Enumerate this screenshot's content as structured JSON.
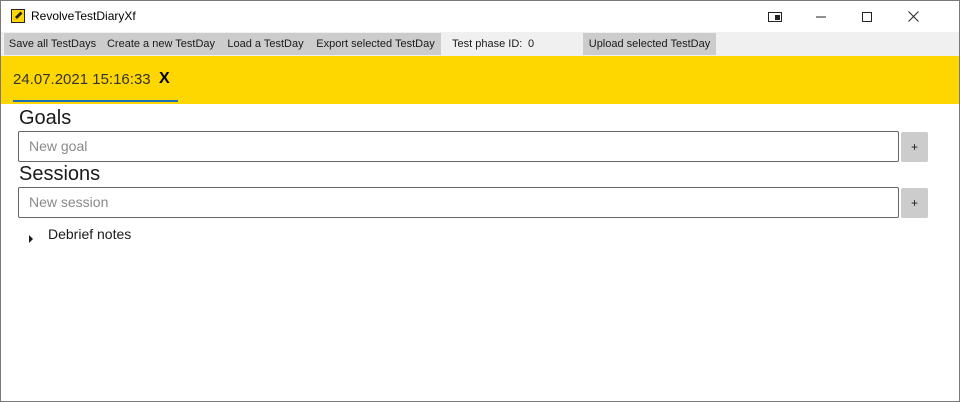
{
  "window": {
    "title": "RevolveTestDiaryXf",
    "app_icon": "pencil-icon",
    "controls": [
      "compact-overlay-icon",
      "minimize-icon",
      "maximize-icon",
      "close-icon"
    ]
  },
  "toolbar": {
    "save_all": "Save all TestDays",
    "create_new": "Create a new TestDay",
    "load": "Load a TestDay",
    "export_selected": "Export selected TestDay",
    "phase_label": "Test phase ID:",
    "phase_value": "0",
    "upload_selected": "Upload selected TestDay"
  },
  "tabs": [
    {
      "label": "24.07.2021 15:16:33",
      "close_label": "X",
      "selected": true
    }
  ],
  "main": {
    "goals": {
      "heading": "Goals",
      "placeholder": "New goal",
      "add_label": "+"
    },
    "sessions": {
      "heading": "Sessions",
      "placeholder": "New session",
      "add_label": "+"
    },
    "debrief": {
      "label": "Debrief notes",
      "expanded": false
    }
  },
  "colors": {
    "tab_strip": "#ffd700",
    "tab_underline": "#1a6fb5",
    "button_bg": "#cccccc",
    "toolbar_bg": "#f0f0f0"
  }
}
